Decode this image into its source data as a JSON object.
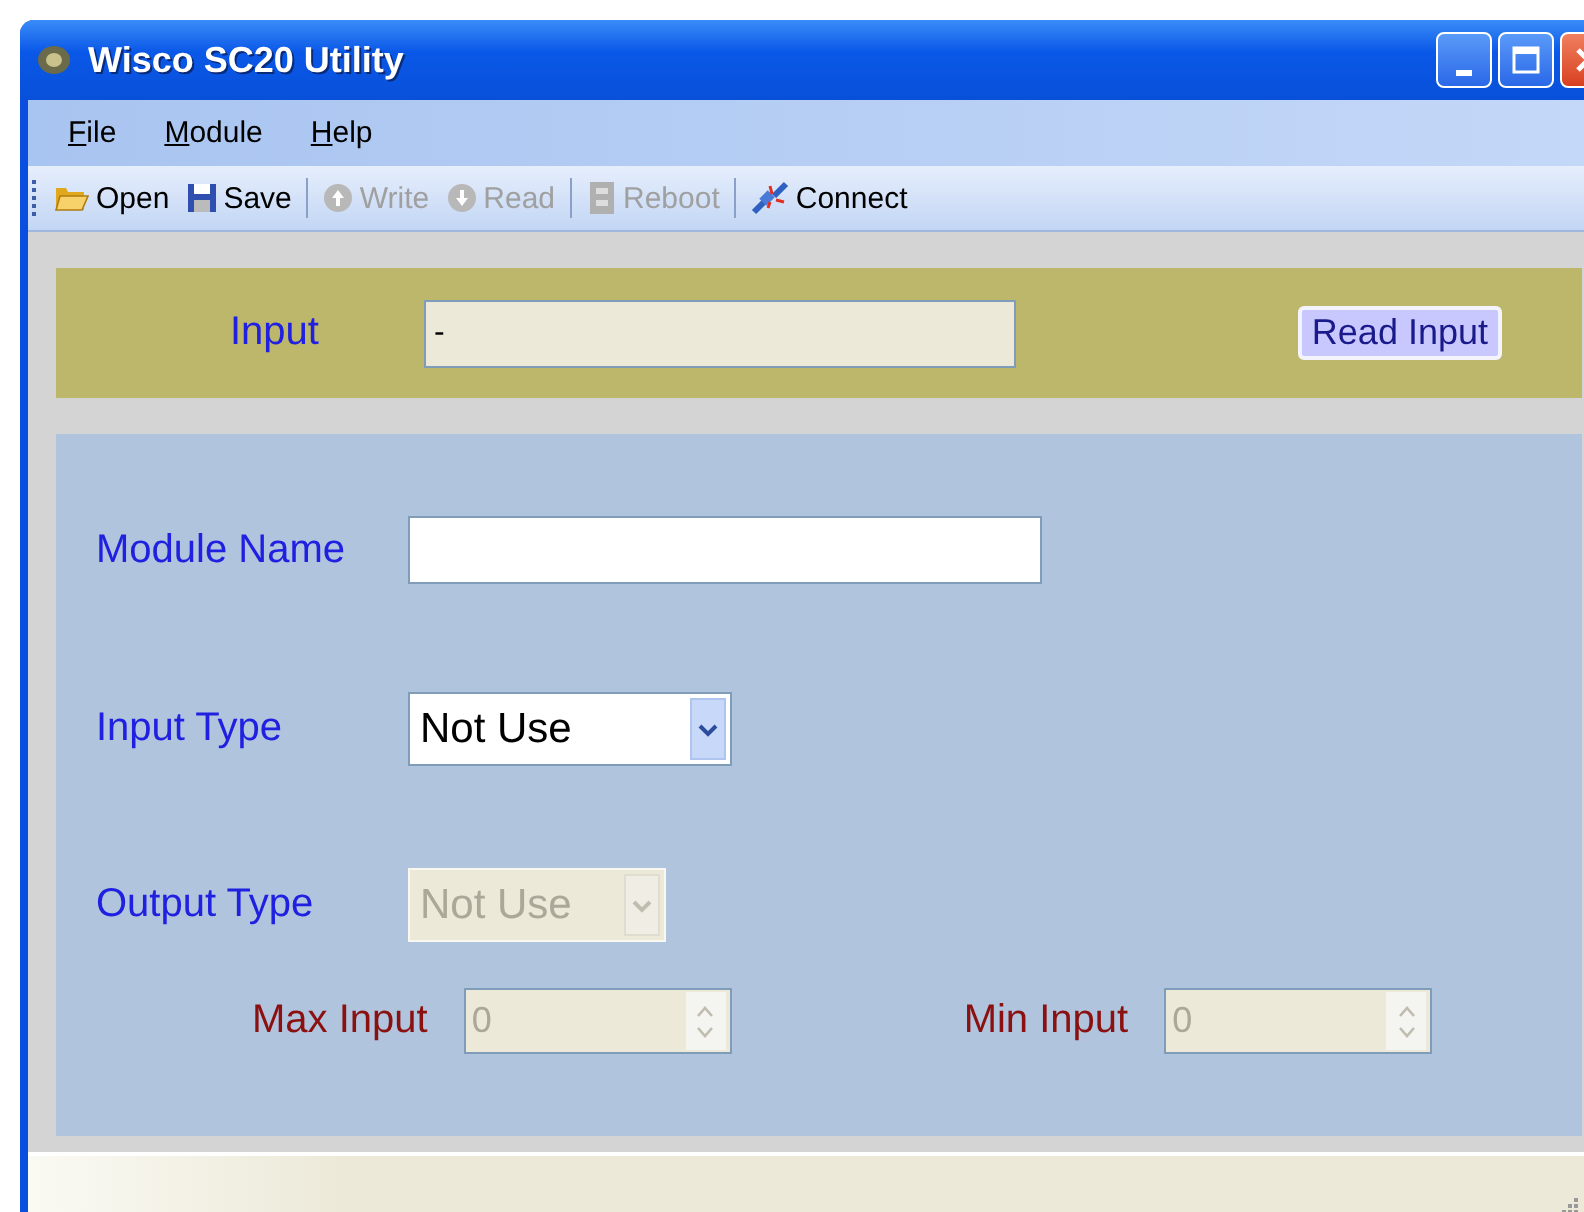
{
  "window": {
    "title": "Wisco SC20 Utility"
  },
  "menu": [
    {
      "label": "File"
    },
    {
      "label": "Module"
    },
    {
      "label": "Help"
    }
  ],
  "toolbar": [
    {
      "label": "Open",
      "kind": "open",
      "disabled": false
    },
    {
      "label": "Save",
      "kind": "save",
      "disabled": false
    },
    {
      "label": "Write",
      "kind": "write",
      "disabled": true
    },
    {
      "label": "Read",
      "kind": "read",
      "disabled": true
    },
    {
      "label": "Reboot",
      "kind": "reboot",
      "disabled": true
    },
    {
      "label": "Connect",
      "kind": "connect",
      "disabled": false
    }
  ],
  "input_panel": {
    "label": "Input",
    "value": "-",
    "button": "Read Input"
  },
  "module_name": {
    "label": "Module Name"
  },
  "input_type": {
    "label": "Input Type",
    "value": "Not Use",
    "disabled": false
  },
  "output_type": {
    "label": "Output Type",
    "value": "Not Use",
    "disabled": true
  },
  "limits": [
    {
      "label": "Max Input",
      "value": "0",
      "disabled": true
    },
    {
      "label": "Min Input",
      "value": "0",
      "disabled": true
    }
  ]
}
